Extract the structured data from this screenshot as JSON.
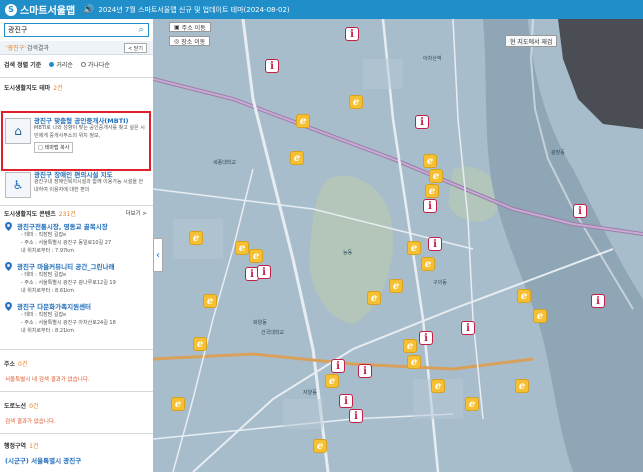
{
  "header": {
    "app_title": "스마트서울맵",
    "notice": "2024년 7월 스마트서울맵 신규 및 업데이트 테마(2024-08-02)"
  },
  "sidebar": {
    "search_value": "광진구",
    "result_keyword": "'광진구'",
    "result_label": "검색결과",
    "collapse_label": "< 닫기",
    "sort": {
      "label": "검색 정렬 기준",
      "options": [
        "거리순",
        "가나다순"
      ],
      "selected": "거리순"
    },
    "theme_section": {
      "title": "도시생활지도 테마",
      "count": "2건"
    },
    "themes": [
      {
        "name": "광진구 맞춤형 공인중개사(MBTI)",
        "desc": "MBTI로 나와 성향이 맞는 공인중개사를 찾고 싶은 시민에게 중개사무소의 위치 정보,",
        "button": "테마맵 복사"
      },
      {
        "name": "광진구 장애인 편의시설 지도",
        "desc": "광진구내 장애인복지시설과 함께 이용가능 시설을 안내하여 이용자에 대한 편의"
      }
    ],
    "content_section": {
      "title": "도시생활지도 콘텐츠",
      "count": "231건",
      "more": "더보기 >"
    },
    "contents": [
      {
        "title": "광진구전통시장, 영동교 골목시장",
        "lines": [
          "- 테마 : 직장맘 길잡e",
          "- 주소 : 서울특별시 광진구 동일로10길 27",
          "내 위치로부터 : 7.97km"
        ]
      },
      {
        "title": "광진구 마을커뮤니티 공간_그린나래",
        "lines": [
          "- 테마 : 직장맘 길잡e",
          "- 주소 : 서울특별시 광진구 광나루로12길 19",
          "내 위치로부터 : 8.61km"
        ]
      },
      {
        "title": "광진구 다문화가족지원센터",
        "lines": [
          "- 테마 : 직장맘 길잡e",
          "- 주소 : 서울특별시 광진구 아차산로24길 18",
          "내 위치로부터 : 8.21km"
        ]
      }
    ],
    "address_section": {
      "title": "주소",
      "count": "0건",
      "empty": "서울특별시 내 검색 결과가 없습니다."
    },
    "road_section": {
      "title": "도로노선",
      "count": "0건",
      "empty": "검색 결과가 없습니다."
    },
    "admin_section": {
      "title": "행정구역",
      "count": "1건",
      "item": "(시군구) 서울특별시 광진구"
    }
  },
  "map": {
    "buttons": {
      "address_move": "주소 이동",
      "place_move": "장소 이동"
    },
    "current_map": "현 지도에서 재검",
    "labels": {
      "l1": "아차산역",
      "l2": "광장동",
      "l3": "자양동",
      "l4": "구의동",
      "l5": "능동",
      "l6": "화양동",
      "l7": "건국대학교",
      "l8": "세종대학교"
    },
    "colors": {
      "accent": "#1f8ec9",
      "highlight": "#e0202a",
      "edu_marker": "#f5c033",
      "info_marker": "#c02048"
    }
  }
}
